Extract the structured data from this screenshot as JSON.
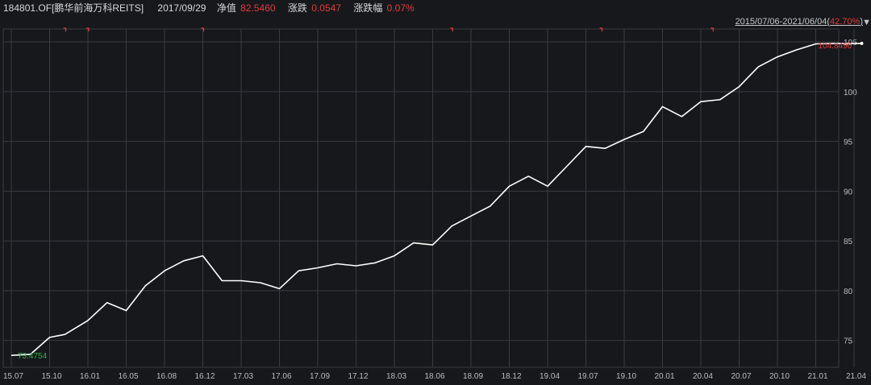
{
  "header": {
    "code": "184801.OF[鹏华前海万科REITS]",
    "date": "2017/09/29",
    "nav_label": "净值",
    "nav_value": "82.5460",
    "chg_label": "涨跌",
    "chg_value": "0.0547",
    "pct_label": "涨跌幅",
    "pct_value": "0.07%"
  },
  "range": {
    "period": "2015/07/06-2021/06/04",
    "pct_open": "(",
    "pct": "42.70%",
    "pct_close": ")",
    "toggle_icon": "▼"
  },
  "colors": {
    "background": "#17181c",
    "line": "#ffffff",
    "grid": "#3a3b40",
    "up": "#e23b3b",
    "down": "#2fb344"
  },
  "chart_data": {
    "type": "line",
    "xlabels": [
      "15.07",
      "15.10",
      "16.01",
      "16.05",
      "16.08",
      "16.12",
      "17.03",
      "17.06",
      "17.09",
      "17.12",
      "18.03",
      "18.06",
      "18.09",
      "18.12",
      "19.04",
      "19.07",
      "19.10",
      "20.01",
      "20.04",
      "20.07",
      "20.10",
      "21.01",
      "21.04"
    ],
    "ylim": [
      72.3,
      106.3
    ],
    "yticks": [
      75,
      80,
      85,
      90,
      95,
      100,
      105
    ],
    "grid": true,
    "first_label": "73.4754",
    "last_label": "104.8490",
    "series": [
      {
        "x": [
          0,
          0.5,
          1,
          1.4,
          2,
          2.5,
          3,
          3.5,
          4,
          4.5,
          5,
          5.5,
          6,
          6.5,
          7,
          7.5,
          8,
          8.5,
          9,
          9.5,
          10,
          10.5,
          11,
          11.5,
          12,
          12.5,
          13,
          13.5,
          14,
          14.5,
          15,
          15.5,
          16,
          16.5,
          17,
          17.5,
          18,
          18.5,
          19,
          19.5,
          20,
          20.5,
          21,
          21.5,
          22,
          22.2
        ],
        "y": [
          73.5,
          73.6,
          75.3,
          75.6,
          77.0,
          78.8,
          78.0,
          80.5,
          82.0,
          83.0,
          83.5,
          81.0,
          81.0,
          80.8,
          80.2,
          82.0,
          82.3,
          82.7,
          82.5,
          82.8,
          83.5,
          84.8,
          84.6,
          86.5,
          87.5,
          88.5,
          90.5,
          91.5,
          90.5,
          92.5,
          94.5,
          94.3,
          95.2,
          96.0,
          98.5,
          97.5,
          99.0,
          99.2,
          100.5,
          102.5,
          103.5,
          104.2,
          104.8,
          104.85,
          104.85,
          104.85
        ]
      }
    ],
    "event_markers": [
      1.4,
      2.0,
      5.0,
      11.5,
      15.4,
      18.3
    ]
  }
}
